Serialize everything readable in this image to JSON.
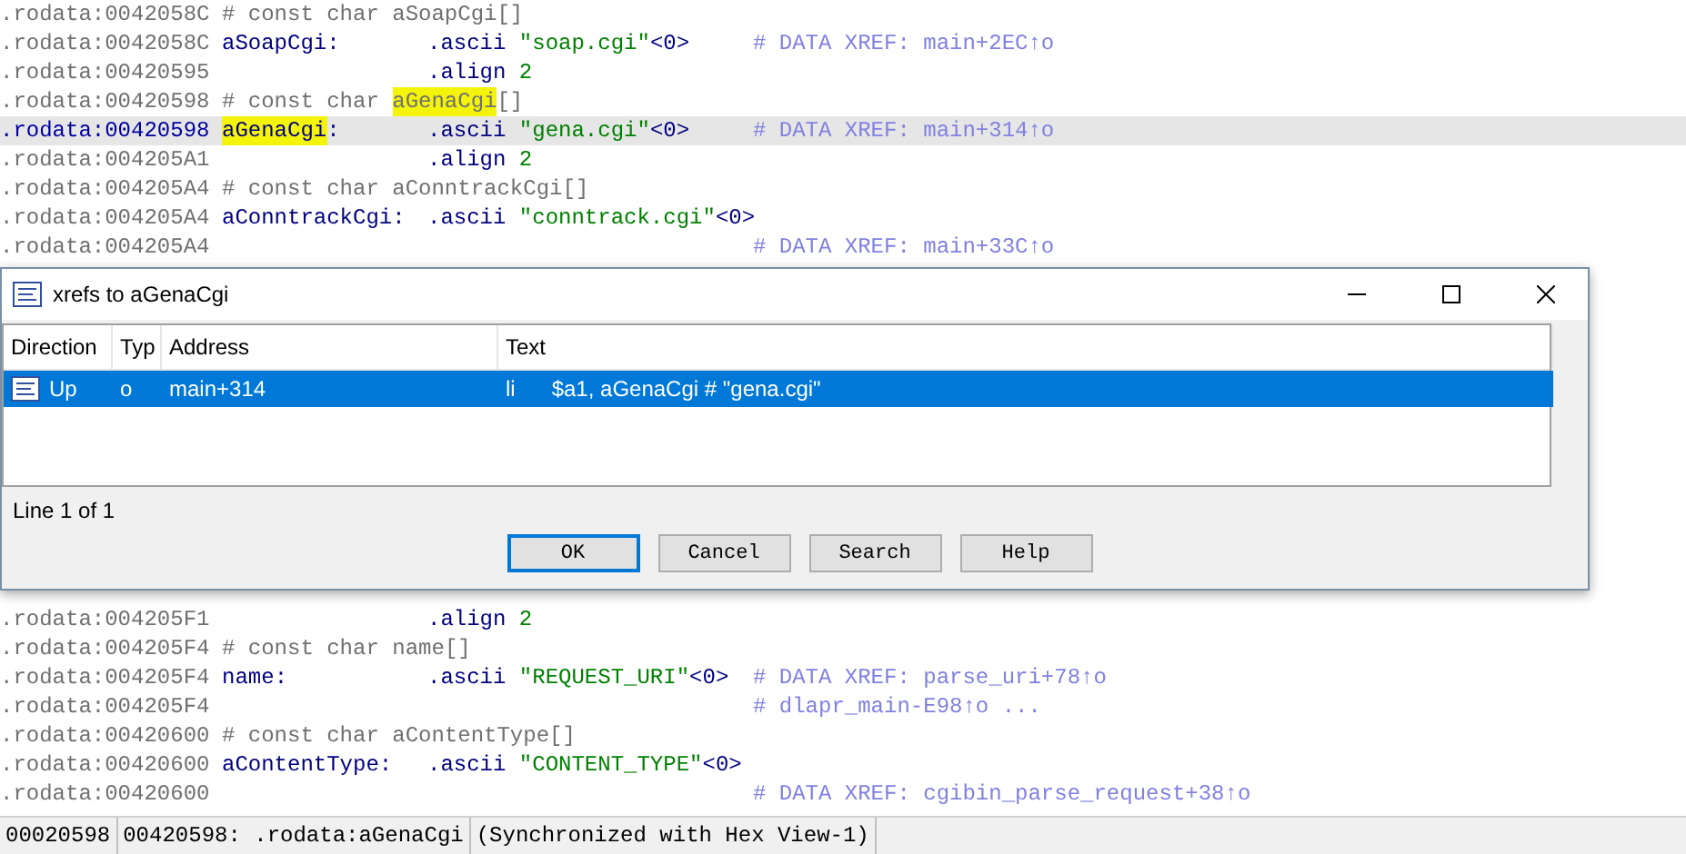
{
  "listing_top": [
    {
      "kind": "decl",
      "address": ".rodata:0042058C",
      "declaration": "# const char",
      "name": "aSoapCgi",
      "brackets": "[]",
      "highlighted": false
    },
    {
      "kind": "data",
      "address": ".rodata:0042058C",
      "label": "aSoapCgi",
      "label_suffix": ":",
      "highlighted": false,
      "current": false,
      "directive": ".ascii",
      "string": "\"soap.cgi\"",
      "terminator": "<0>",
      "xref": "# DATA XREF: main+2EC↑o"
    },
    {
      "kind": "align",
      "address": ".rodata:00420595",
      "directive": ".align",
      "value": "2"
    },
    {
      "kind": "decl",
      "address": ".rodata:00420598",
      "declaration": "# const char",
      "name": "aGenaCgi",
      "brackets": "[]",
      "highlighted": true
    },
    {
      "kind": "data",
      "address": ".rodata:00420598",
      "label": "aGenaCgi",
      "label_suffix": ":",
      "highlighted": true,
      "current": true,
      "directive": ".ascii",
      "string": "\"gena.cgi\"",
      "terminator": "<0>",
      "xref": "# DATA XREF: main+314↑o"
    },
    {
      "kind": "align",
      "address": ".rodata:004205A1",
      "directive": ".align",
      "value": "2"
    },
    {
      "kind": "decl",
      "address": ".rodata:004205A4",
      "declaration": "# const char",
      "name": "aConntrackCgi",
      "brackets": "[]",
      "highlighted": false
    },
    {
      "kind": "data",
      "address": ".rodata:004205A4",
      "label": "aConntrackCgi",
      "label_suffix": ":",
      "highlighted": false,
      "current": false,
      "directive": ".ascii",
      "string": "\"conntrack.cgi\"",
      "terminator": "<0>"
    },
    {
      "kind": "xref",
      "address": ".rodata:004205A4",
      "xref": "# DATA XREF: main+33C↑o"
    }
  ],
  "dialog": {
    "title": "xrefs to aGenaCgi",
    "columns": [
      "Direction",
      "Typ",
      "Address",
      "Text"
    ],
    "rows": [
      {
        "direction": "Up",
        "type": "o",
        "address": "main+314",
        "text": "li      $a1, aGenaCgi # \"gena.cgi\"",
        "selected": true
      }
    ],
    "status": "Line 1 of 1",
    "buttons": [
      {
        "label": "OK",
        "default": true
      },
      {
        "label": "Cancel",
        "default": false
      },
      {
        "label": "Search",
        "default": false
      },
      {
        "label": "Help",
        "default": false
      }
    ]
  },
  "listing_bottom": [
    {
      "kind": "align",
      "address": ".rodata:004205F1",
      "directive": ".align",
      "value": "2"
    },
    {
      "kind": "decl",
      "address": ".rodata:004205F4",
      "declaration": "# const char",
      "name": "name",
      "brackets": "[]",
      "highlighted": false
    },
    {
      "kind": "data",
      "address": ".rodata:004205F4",
      "label": "name",
      "label_suffix": ":",
      "highlighted": false,
      "current": false,
      "directive": ".ascii",
      "string": "\"REQUEST_URI\"",
      "terminator": "<0>",
      "xref": "# DATA XREF: parse_uri+78↑o"
    },
    {
      "kind": "xref",
      "address": ".rodata:004205F4",
      "xref": "# dlapr_main-E98↑o ..."
    },
    {
      "kind": "decl",
      "address": ".rodata:00420600",
      "declaration": "# const char",
      "name": "aContentType",
      "brackets": "[]",
      "highlighted": false
    },
    {
      "kind": "data",
      "address": ".rodata:00420600",
      "label": "aContentType",
      "label_suffix": ":",
      "highlighted": false,
      "current": false,
      "directive": ".ascii",
      "string": "\"CONTENT_TYPE\"",
      "terminator": "<0>"
    },
    {
      "kind": "xref",
      "address": ".rodata:00420600",
      "xref": "# DATA XREF: cgibin_parse_request+38↑o"
    }
  ],
  "status_bar": [
    "00020598",
    "00420598: .rodata:aGenaCgi",
    "(Synchronized with Hex View-1)"
  ]
}
